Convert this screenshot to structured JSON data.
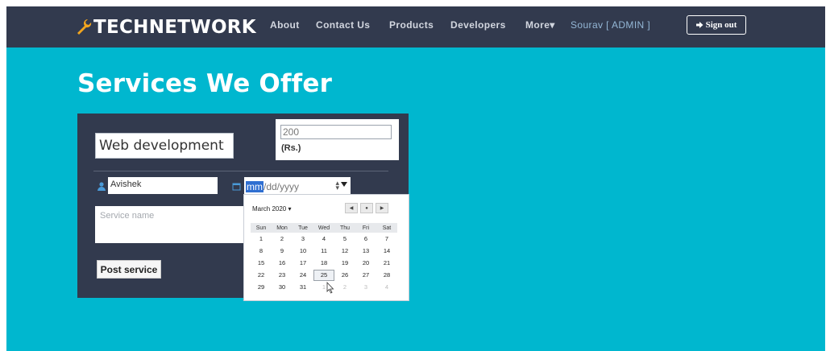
{
  "navbar": {
    "brand": "TECHNETWORK",
    "links": [
      "About",
      "Contact Us",
      "Products",
      "Developers",
      "More▾"
    ],
    "user": "Sourav [ ADMIN ]",
    "signout_label": "Sign out"
  },
  "page": {
    "title": "Services We Offer"
  },
  "form": {
    "service_value": "Web development",
    "price_value": "200",
    "currency_label": "(Rs.)",
    "author_value": "Avishek",
    "date_mm": "mm",
    "date_rest": "/dd/yyyy",
    "description_placeholder": "Service name",
    "post_label": "Post service"
  },
  "calendar": {
    "month_label": "March 2020 ▾",
    "weekdays": [
      "Sun",
      "Mon",
      "Tue",
      "Wed",
      "Thu",
      "Fri",
      "Sat"
    ],
    "weeks": [
      [
        "1",
        "2",
        "3",
        "4",
        "5",
        "6",
        "7"
      ],
      [
        "8",
        "9",
        "10",
        "11",
        "12",
        "13",
        "14"
      ],
      [
        "15",
        "16",
        "17",
        "18",
        "19",
        "20",
        "21"
      ],
      [
        "22",
        "23",
        "24",
        "25",
        "26",
        "27",
        "28"
      ],
      [
        "29",
        "30",
        "31",
        "1",
        "2",
        "3",
        "4"
      ]
    ],
    "today": "25"
  },
  "colors": {
    "page_bg": "#00b7cf",
    "navbar_bg": "#323a4e",
    "panel_bg": "#323a4e"
  }
}
